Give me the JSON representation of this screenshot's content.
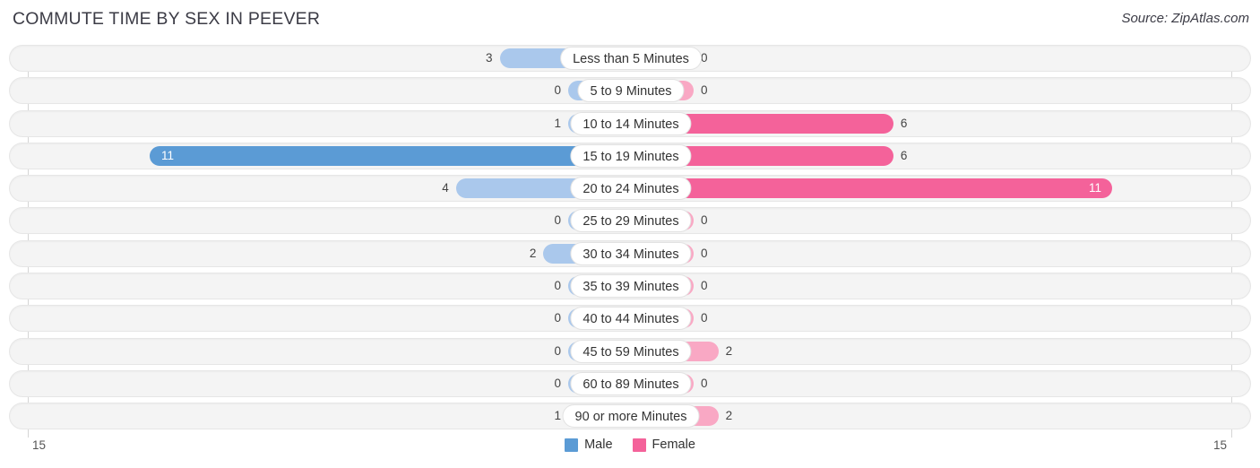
{
  "header": {
    "title": "COMMUTE TIME BY SEX IN PEEVER",
    "source": "Source: ZipAtlas.com"
  },
  "legend": {
    "male_label": "Male",
    "female_label": "Female",
    "male_color": "#5b9bd5",
    "female_color": "#f4629a"
  },
  "axis": {
    "left_end": "15",
    "right_end": "15"
  },
  "colors": {
    "male_light": "#aac8ec",
    "male_dark": "#5b9bd5",
    "female_light": "#f9a8c4",
    "female_dark": "#f4629a",
    "track": "#f4f4f4"
  },
  "chart_data": {
    "type": "bar",
    "orientation": "horizontal-diverging",
    "title": "COMMUTE TIME BY SEX IN PEEVER",
    "xlabel": "",
    "ylabel": "",
    "xlim": [
      15,
      15
    ],
    "grid": false,
    "legend_position": "bottom-center",
    "categories": [
      "Less than 5 Minutes",
      "5 to 9 Minutes",
      "10 to 14 Minutes",
      "15 to 19 Minutes",
      "20 to 24 Minutes",
      "25 to 29 Minutes",
      "30 to 34 Minutes",
      "35 to 39 Minutes",
      "40 to 44 Minutes",
      "45 to 59 Minutes",
      "60 to 89 Minutes",
      "90 or more Minutes"
    ],
    "series": [
      {
        "name": "Male",
        "values": [
          3,
          0,
          1,
          11,
          4,
          0,
          2,
          0,
          0,
          0,
          0,
          1
        ]
      },
      {
        "name": "Female",
        "values": [
          0,
          0,
          6,
          6,
          11,
          0,
          0,
          0,
          0,
          2,
          0,
          2
        ]
      }
    ],
    "max_value": 11
  },
  "rows": [
    {
      "label": "Less than 5 Minutes",
      "male": "3",
      "female": "0"
    },
    {
      "label": "5 to 9 Minutes",
      "male": "0",
      "female": "0"
    },
    {
      "label": "10 to 14 Minutes",
      "male": "1",
      "female": "6"
    },
    {
      "label": "15 to 19 Minutes",
      "male": "11",
      "female": "6"
    },
    {
      "label": "20 to 24 Minutes",
      "male": "4",
      "female": "11"
    },
    {
      "label": "25 to 29 Minutes",
      "male": "0",
      "female": "0"
    },
    {
      "label": "30 to 34 Minutes",
      "male": "2",
      "female": "0"
    },
    {
      "label": "35 to 39 Minutes",
      "male": "0",
      "female": "0"
    },
    {
      "label": "40 to 44 Minutes",
      "male": "0",
      "female": "0"
    },
    {
      "label": "45 to 59 Minutes",
      "male": "0",
      "female": "2"
    },
    {
      "label": "60 to 89 Minutes",
      "male": "0",
      "female": "0"
    },
    {
      "label": "90 or more Minutes",
      "male": "1",
      "female": "2"
    }
  ]
}
